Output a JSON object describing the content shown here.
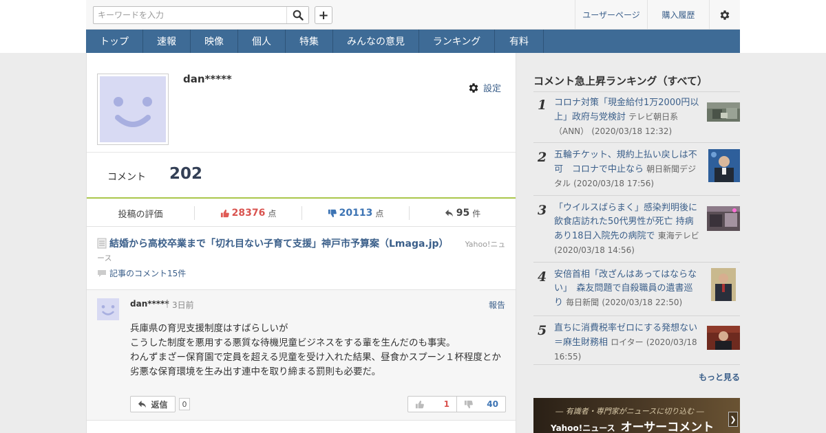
{
  "header": {
    "search_placeholder": "キーワードを入力",
    "user_page": "ユーザーページ",
    "purchase_history": "購入履歴"
  },
  "nav": [
    {
      "label": "トップ"
    },
    {
      "label": "速報"
    },
    {
      "label": "映像"
    },
    {
      "label": "個人"
    },
    {
      "label": "特集"
    },
    {
      "label": "みんなの意見"
    },
    {
      "label": "ランキング"
    },
    {
      "label": "有料"
    }
  ],
  "profile": {
    "username": "dan*****",
    "settings_label": "設定",
    "comment_label": "コメント",
    "comment_count": "202"
  },
  "evaluation": {
    "label": "投稿の評価",
    "good": "28376",
    "bad": "20113",
    "replies": "95",
    "point_unit": "点",
    "count_unit": "件"
  },
  "article": {
    "title": "結婚から高校卒業まで「切れ目ない子育て支援」神戸市予算案（Lmaga.jp）",
    "source": "Yahoo!ニュース",
    "comments_link": "記事のコメント15件"
  },
  "comment": {
    "user": "dan*****",
    "separator": "|",
    "time": "3日前",
    "report": "報告",
    "body_lines": [
      "兵庫県の育児支援制度はすばらしいが",
      "こうした制度を悪用する悪質な待機児童ビジネスをする輩を生んだのも事実。",
      "わんずまざー保育園で定員を超える児童を受け入れた結果、昼食かスプーン１杯程度とか",
      "劣悪な保育環境を生み出す連中を取り締まる罰則も必要だ。"
    ],
    "reply_label": "返信",
    "reply_count": "0",
    "good_votes": "1",
    "bad_votes": "40"
  },
  "sidebar": {
    "title": "コメント急上昇ランキング（すべて）",
    "items": [
      {
        "rank": "1",
        "title": "コロナ対策「現金給付1万2000円以上」政府与党検討",
        "source": "テレビ朝日系（ANN）",
        "time": "(2020/03/18 12:32)"
      },
      {
        "rank": "2",
        "title": "五輪チケット、規約上払い戻しは不可　コロナで中止なら",
        "source": "朝日新聞デジタル",
        "time": "(2020/03/18 17:56)"
      },
      {
        "rank": "3",
        "title": "「ウイルスばらまく」感染判明後に飲食店訪れた50代男性が死亡 持病あり18日入院先の病院で",
        "source": "東海テレビ",
        "time": "(2020/03/18 14:56)"
      },
      {
        "rank": "4",
        "title": "安倍首相「改ざんはあってはならない」　森友問題で自殺職員の遺書巡り",
        "source": "毎日新聞",
        "time": "(2020/03/18 22:50)"
      },
      {
        "rank": "5",
        "title": "直ちに消費税率ゼロにする発想ない＝麻生財務相",
        "source": "ロイター",
        "time": "(2020/03/18 16:55)"
      }
    ],
    "more": "もっと見る",
    "banner": {
      "sub": "― 有識者・専門家がニュースに切り込む ―",
      "brand": "Yahoo!ニュース",
      "name": "オーサーコメント"
    }
  },
  "colors": {
    "nav_bg": "#3e6b96",
    "link": "#3b5f8a",
    "good": "#d9534f",
    "bad": "#3d74b4",
    "accent_line": "#a9c64a",
    "avatar_bg": "#d8daf3"
  }
}
